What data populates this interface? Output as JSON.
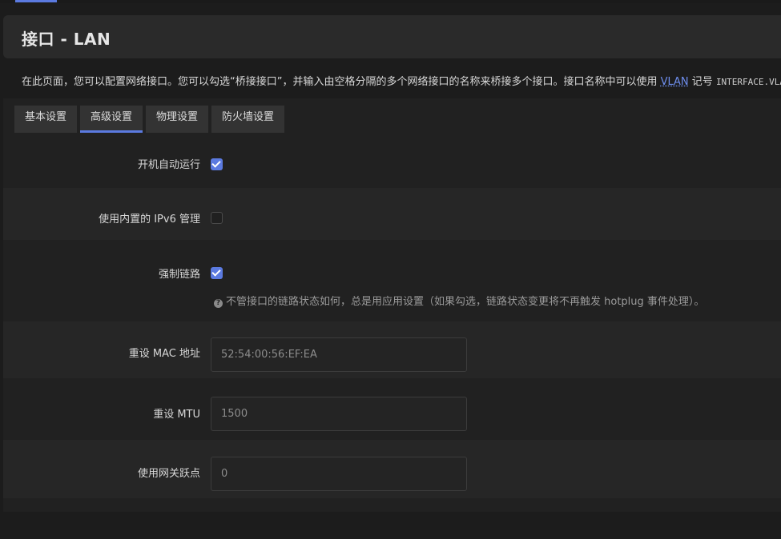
{
  "page": {
    "title": "接口 - LAN",
    "description_prefix": "在此页面，您可以配置网络接口。您可以勾选“桥接接口”，并输入由空格分隔的多个网络接口的名称来桥接多个接口。接口名称中可以使用 ",
    "description_link": "VLAN",
    "description_mid": " 记号 ",
    "description_code": "INTERFACE.VLANNR"
  },
  "tabs": [
    {
      "label": "基本设置",
      "active": false
    },
    {
      "label": "高级设置",
      "active": true
    },
    {
      "label": "物理设置",
      "active": false
    },
    {
      "label": "防火墙设置",
      "active": false
    }
  ],
  "fields": {
    "auto_start": {
      "label": "开机自动运行",
      "checked": true
    },
    "ipv6_mgmt": {
      "label": "使用内置的 IPv6 管理",
      "checked": false
    },
    "force_link": {
      "label": "强制链路",
      "checked": true,
      "hint": "不管接口的链路状态如何，总是用应用设置（如果勾选，链路状态变更将不再触发 hotplug 事件处理）。"
    },
    "mac": {
      "label": "重设 MAC 地址",
      "placeholder": "52:54:00:56:EF:EA"
    },
    "mtu": {
      "label": "重设 MTU",
      "placeholder": "1500"
    },
    "metric": {
      "label": "使用网关跃点",
      "placeholder": "0"
    }
  },
  "colors": {
    "accent": "#5b7ae0",
    "background": "#1c1c1c",
    "panel": "#212121"
  }
}
